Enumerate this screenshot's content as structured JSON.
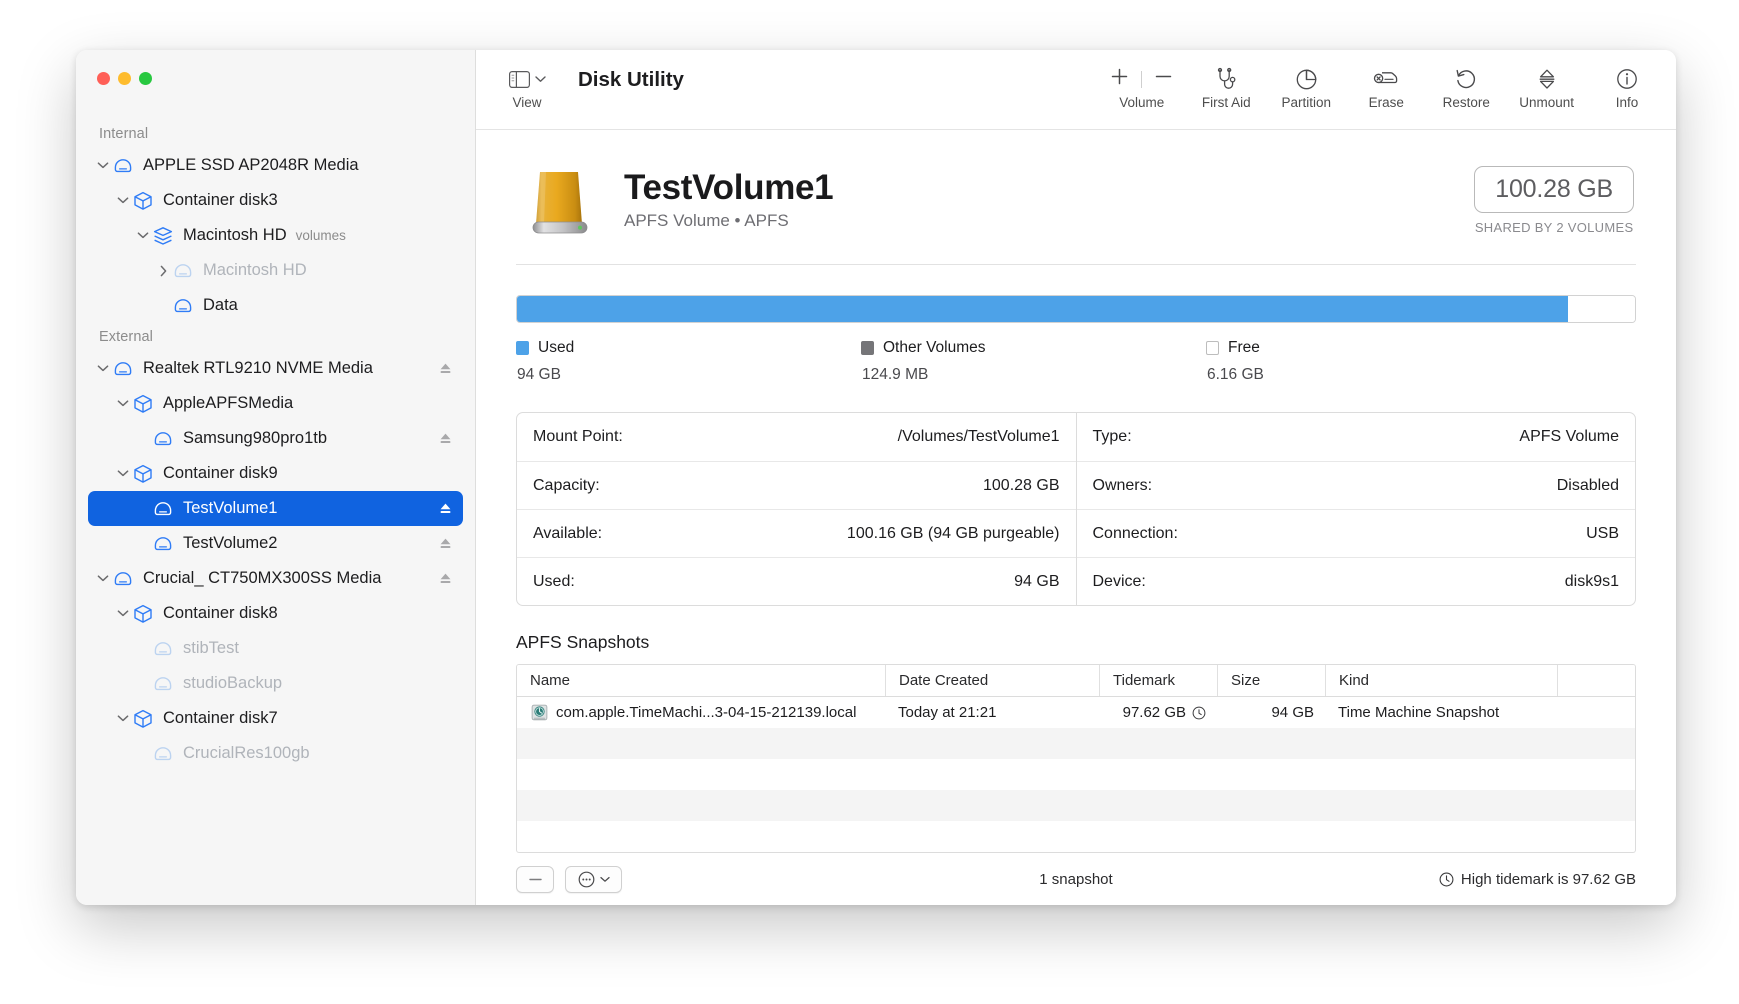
{
  "window": {
    "title": "Disk Utility",
    "traffic_lights": [
      "close",
      "minimize",
      "zoom"
    ]
  },
  "toolbar": {
    "view_label": "View",
    "volume_label": "Volume",
    "volume_add": "+",
    "volume_remove": "−",
    "items": [
      {
        "label": "First Aid",
        "icon": "stethoscope-icon"
      },
      {
        "label": "Partition",
        "icon": "pie-chart-icon"
      },
      {
        "label": "Erase",
        "icon": "erase-disk-icon"
      },
      {
        "label": "Restore",
        "icon": "restore-arrow-icon"
      },
      {
        "label": "Unmount",
        "icon": "unmount-icon"
      },
      {
        "label": "Info",
        "icon": "info-circle-icon"
      }
    ]
  },
  "sidebar": {
    "groups": [
      {
        "label": "Internal",
        "rows": [
          {
            "label": "APPLE SSD AP2048R Media",
            "indent": 0,
            "icon": "drive-icon",
            "disclosure": "down",
            "dim": false,
            "eject": false,
            "selected": false,
            "sub": ""
          },
          {
            "label": "Container disk3",
            "indent": 1,
            "icon": "container-icon",
            "disclosure": "down",
            "dim": false,
            "eject": false,
            "selected": false,
            "sub": ""
          },
          {
            "label": "Macintosh HD",
            "indent": 2,
            "icon": "volume-group-icon",
            "disclosure": "down",
            "dim": false,
            "eject": false,
            "selected": false,
            "sub": "volumes"
          },
          {
            "label": "Macintosh HD",
            "indent": 3,
            "icon": "drive-icon",
            "disclosure": "right",
            "dim": true,
            "eject": false,
            "selected": false,
            "sub": ""
          },
          {
            "label": "Data",
            "indent": 3,
            "icon": "drive-icon",
            "disclosure": "none",
            "dim": false,
            "eject": false,
            "selected": false,
            "sub": ""
          }
        ]
      },
      {
        "label": "External",
        "rows": [
          {
            "label": "Realtek RTL9210 NVME Media",
            "indent": 0,
            "icon": "drive-icon",
            "disclosure": "down",
            "dim": false,
            "eject": true,
            "selected": false,
            "sub": ""
          },
          {
            "label": "AppleAPFSMedia",
            "indent": 1,
            "icon": "container-icon",
            "disclosure": "down",
            "dim": false,
            "eject": false,
            "selected": false,
            "sub": ""
          },
          {
            "label": "Samsung980pro1tb",
            "indent": 2,
            "icon": "drive-icon",
            "disclosure": "none",
            "dim": false,
            "eject": true,
            "selected": false,
            "sub": ""
          },
          {
            "label": "Container disk9",
            "indent": 1,
            "icon": "container-icon",
            "disclosure": "down",
            "dim": false,
            "eject": false,
            "selected": false,
            "sub": ""
          },
          {
            "label": "TestVolume1",
            "indent": 2,
            "icon": "drive-icon",
            "disclosure": "none",
            "dim": false,
            "eject": true,
            "selected": true,
            "sub": ""
          },
          {
            "label": "TestVolume2",
            "indent": 2,
            "icon": "drive-icon",
            "disclosure": "none",
            "dim": false,
            "eject": true,
            "selected": false,
            "sub": ""
          },
          {
            "label": "Crucial_ CT750MX300SS Media",
            "indent": 0,
            "icon": "drive-icon",
            "disclosure": "down",
            "dim": false,
            "eject": true,
            "selected": false,
            "sub": ""
          },
          {
            "label": "Container disk8",
            "indent": 1,
            "icon": "container-icon",
            "disclosure": "down",
            "dim": false,
            "eject": false,
            "selected": false,
            "sub": ""
          },
          {
            "label": "stibTest",
            "indent": 2,
            "icon": "drive-icon",
            "disclosure": "none",
            "dim": true,
            "eject": false,
            "selected": false,
            "sub": ""
          },
          {
            "label": "studioBackup",
            "indent": 2,
            "icon": "drive-icon",
            "disclosure": "none",
            "dim": true,
            "eject": false,
            "selected": false,
            "sub": ""
          },
          {
            "label": "Container disk7",
            "indent": 1,
            "icon": "container-icon",
            "disclosure": "down",
            "dim": false,
            "eject": false,
            "selected": false,
            "sub": ""
          },
          {
            "label": "CrucialRes100gb",
            "indent": 2,
            "icon": "drive-icon",
            "disclosure": "none",
            "dim": true,
            "eject": false,
            "selected": false,
            "sub": ""
          }
        ]
      }
    ]
  },
  "volume": {
    "name": "TestVolume1",
    "subtitle": "APFS Volume • APFS",
    "capacity_badge": "100.28 GB",
    "shared_note": "SHARED BY 2 VOLUMES",
    "icon": "external-hard-drive-icon"
  },
  "usage": {
    "used_percent": 94,
    "other_percent": 0.12,
    "free_percent": 5.88,
    "legend": [
      {
        "name": "Used",
        "value": "94 GB",
        "color": "#4da2e8",
        "swatch": "sw-used"
      },
      {
        "name": "Other Volumes",
        "value": "124.9 MB",
        "color": "#757578",
        "swatch": "sw-other"
      },
      {
        "name": "Free",
        "value": "6.16 GB",
        "color": "#ffffff",
        "swatch": "sw-free"
      }
    ]
  },
  "info": {
    "left": [
      {
        "key": "Mount Point:",
        "value": "/Volumes/TestVolume1"
      },
      {
        "key": "Capacity:",
        "value": "100.28 GB"
      },
      {
        "key": "Available:",
        "value": "100.16 GB (94 GB purgeable)"
      },
      {
        "key": "Used:",
        "value": "94 GB"
      }
    ],
    "right": [
      {
        "key": "Type:",
        "value": "APFS Volume"
      },
      {
        "key": "Owners:",
        "value": "Disabled"
      },
      {
        "key": "Connection:",
        "value": "USB"
      },
      {
        "key": "Device:",
        "value": "disk9s1"
      }
    ]
  },
  "snapshots": {
    "title": "APFS Snapshots",
    "columns": [
      "Name",
      "Date Created",
      "Tidemark",
      "Size",
      "Kind"
    ],
    "rows": [
      {
        "name": "com.apple.TimeMachi...3-04-15-212139.local",
        "date": "Today at 21:21",
        "tidemark": "97.62 GB",
        "size": "94 GB",
        "kind": "Time Machine Snapshot",
        "icon": "time-machine-snapshot-icon",
        "has_clock": true
      }
    ],
    "empty_row_count": 4,
    "footer": {
      "remove_label": "−",
      "action_menu_icon": "ellipsis-circle-icon",
      "count_label": "1 snapshot",
      "tidemark_label": "High tidemark is 97.62 GB",
      "tidemark_icon": "clock-icon"
    }
  }
}
